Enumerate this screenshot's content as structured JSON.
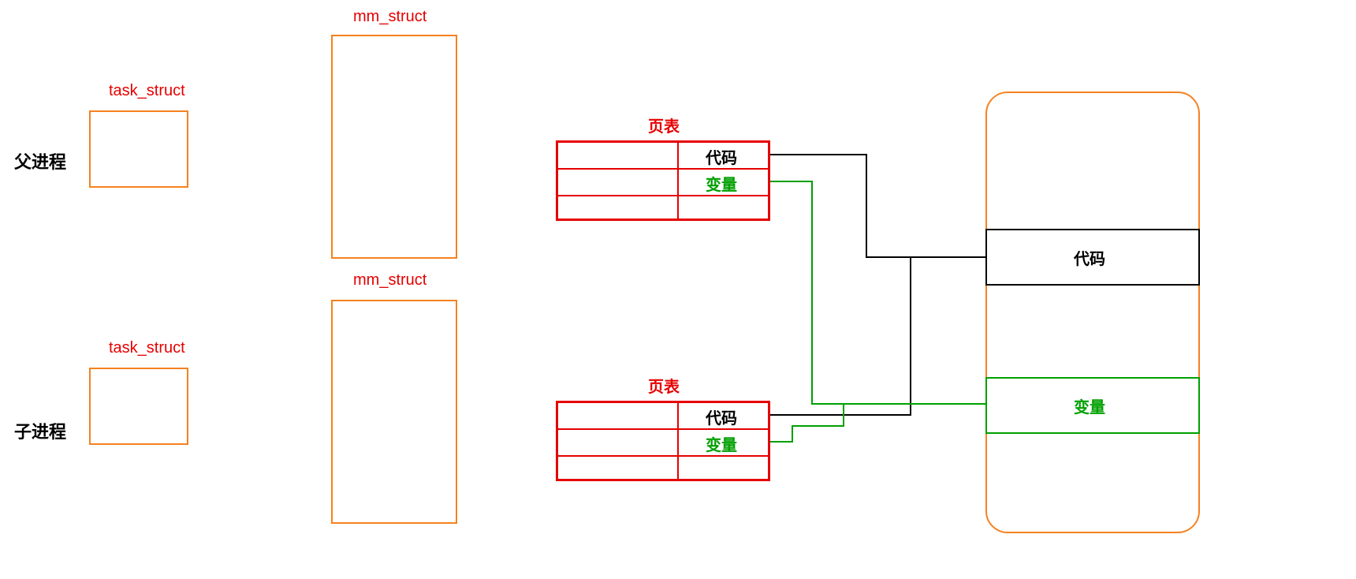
{
  "labels": {
    "parent_process": "父进程",
    "child_process": "子进程",
    "task_struct_parent": "task_struct",
    "task_struct_child": "task_struct",
    "mm_struct_parent": "mm_struct",
    "mm_struct_child": "mm_struct",
    "page_table_parent": "页表",
    "page_table_child": "页表",
    "pt_parent_row0": "代码",
    "pt_parent_row1": "变量",
    "pt_child_row0": "代码",
    "pt_child_row1": "变量",
    "mem_code": "代码",
    "mem_var": "变量"
  },
  "colors": {
    "orange": "#f58220",
    "red": "#e60000",
    "green": "#00a000",
    "black": "#000000"
  }
}
